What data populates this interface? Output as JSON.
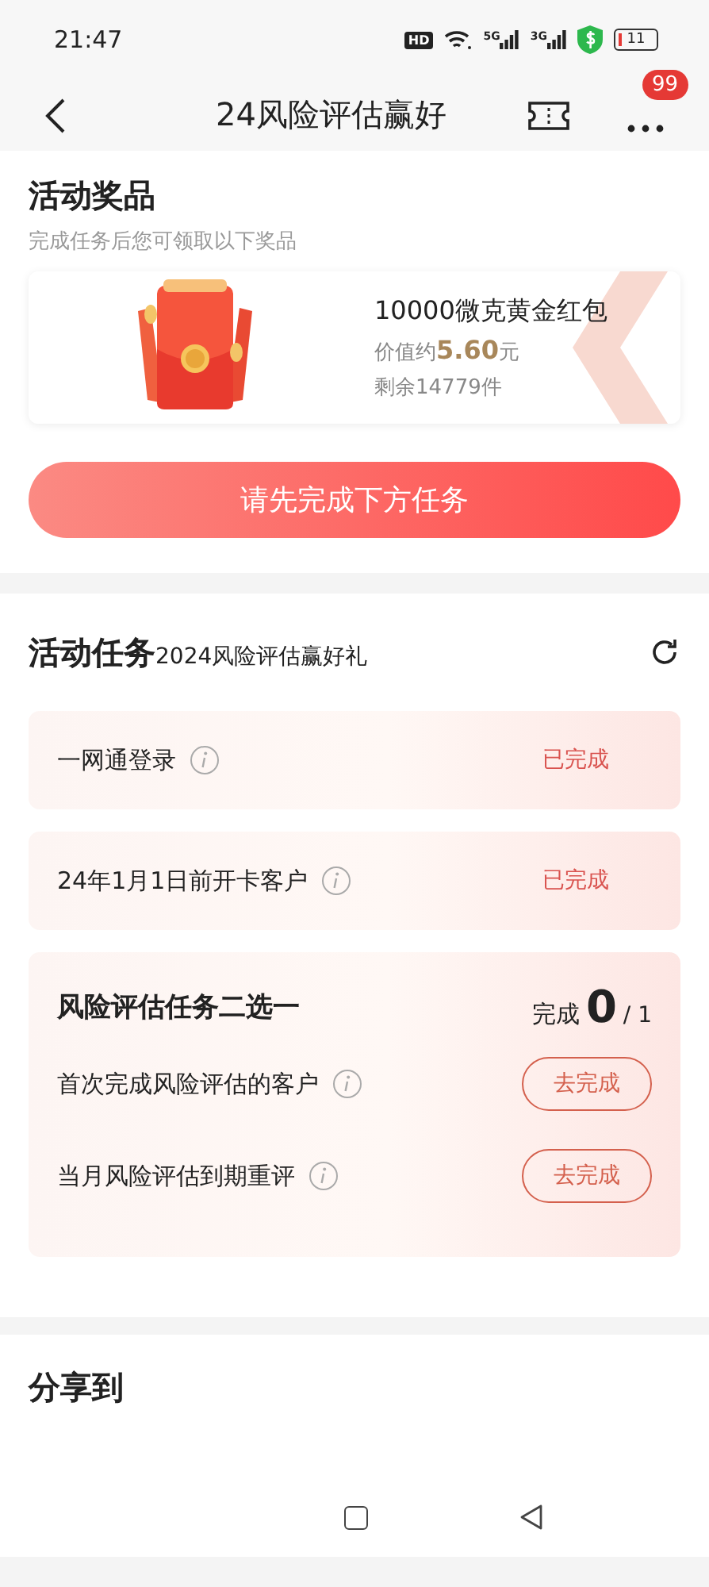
{
  "status_bar": {
    "time": "21:47",
    "hd": "HD",
    "networks": [
      "5G",
      "3G"
    ],
    "battery": "11"
  },
  "nav": {
    "title": "24风险评估赢好",
    "badge": "99"
  },
  "prizes": {
    "title": "活动奖品",
    "subtitle": "完成任务后您可领取以下奖品",
    "items": [
      {
        "kind": "picture",
        "name": "10000微克黄金红包",
        "value_prefix": "价值约",
        "value": "5.60",
        "value_unit": "元",
        "remaining": "剩余14779件"
      }
    ],
    "button": "请先完成下方任务"
  },
  "tasks": {
    "title": "活动任务",
    "subtitle": "2024风险评估赢好礼",
    "items": [
      {
        "kind": "simple",
        "name": "一网通登录",
        "status": "已完成"
      },
      {
        "kind": "simple",
        "name": "24年1月1日前开卡客户",
        "status": "已完成"
      },
      {
        "kind": "group",
        "name": "风险评估任务二选一",
        "progress_label": "完成",
        "done": "0",
        "total": "/ 1",
        "options": [
          {
            "name": "首次完成风险评估的客户",
            "action": "去完成"
          },
          {
            "name": "当月风险评估到期重评",
            "action": "去完成"
          }
        ]
      }
    ]
  },
  "share": {
    "title": "分享到"
  }
}
